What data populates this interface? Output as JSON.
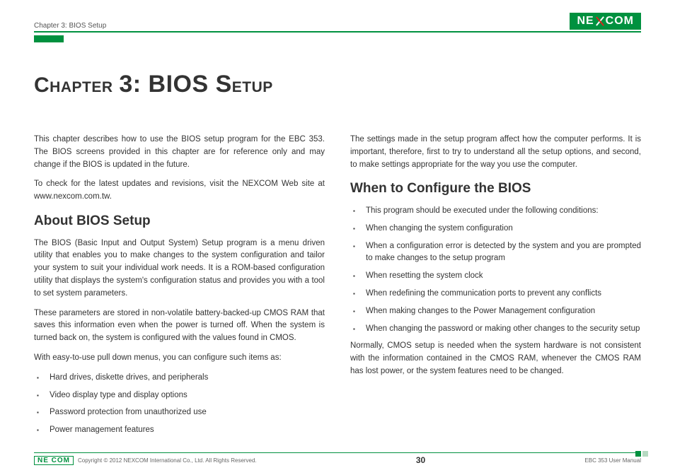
{
  "header": {
    "chapter_label": "Chapter 3: BIOS Setup",
    "logo_text_left": "NE",
    "logo_text_right": "COM"
  },
  "title": {
    "pre": "Chapter ",
    "num": "3: BIOS S",
    "post": "etup"
  },
  "left": {
    "p1": "This chapter describes how to use the BIOS setup program for the EBC 353. The BIOS screens provided in this chapter are for reference only and may change if the BIOS is updated in the future.",
    "p2": "To check for the latest updates and revisions, visit the NEXCOM Web site at www.nexcom.com.tw.",
    "h_about": "About BIOS Setup",
    "p3": "The BIOS (Basic Input and Output System) Setup program is a menu driven utility that enables you to make changes to the system configuration and tailor your system to suit your individual work needs. It is a ROM-based configuration utility that displays the system's configuration status and provides you with a tool to set system parameters.",
    "p4": "These parameters are stored in non-volatile battery-backed-up CMOS RAM that saves this information even when the power is turned off. When the system is turned back on, the system is configured with the values found in CMOS.",
    "p5": "With easy-to-use pull down menus, you can configure such items as:",
    "items": [
      "Hard drives, diskette drives, and peripherals",
      "Video display type and display options",
      "Password protection from unauthorized use",
      "Power management features"
    ]
  },
  "right": {
    "p1": "The settings made in the setup program affect how the computer performs. It is important, therefore, first to try to understand all the setup options, and second, to make settings appropriate for the way you use the computer.",
    "h_when": "When to Configure the BIOS",
    "items": [
      "This program should be executed under the following conditions:",
      "When changing the system configuration",
      "When a configuration error is detected by the system and you are prompted to make changes to the setup program",
      "When resetting the system clock",
      "When redefining the communication ports to prevent any conflicts",
      "When making changes to the Power Management configuration",
      "When changing the password or making other changes to the security setup"
    ],
    "p2": "Normally, CMOS setup is needed when the system hardware is not consistent with the information contained in the CMOS RAM, whenever the CMOS RAM has lost power, or the system features need to be changed."
  },
  "footer": {
    "copy": "Copyright © 2012 NEXCOM International Co., Ltd. All Rights Reserved.",
    "page": "30",
    "manual": "EBC 353 User Manual",
    "logo_small": "NE COM"
  }
}
